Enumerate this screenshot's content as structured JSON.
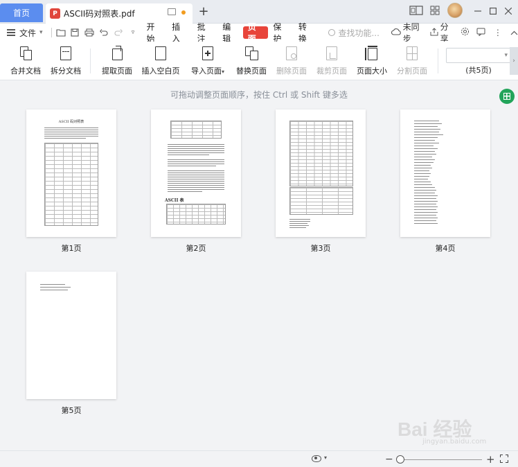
{
  "tabs": {
    "home_label": "首页",
    "document_title": "ASCII码对照表.pdf"
  },
  "menubar": {
    "file_label": "文件",
    "items": [
      "开始",
      "插入",
      "批注",
      "编辑",
      "页面",
      "保护",
      "转换"
    ],
    "active_item": "页面",
    "search_placeholder": "查找功能...",
    "sync_label": "未同步",
    "share_label": "分享"
  },
  "ribbon": {
    "buttons": [
      {
        "label": "合并文档",
        "enabled": true
      },
      {
        "label": "拆分文档",
        "enabled": true
      },
      {
        "label": "提取页面",
        "enabled": true
      },
      {
        "label": "插入空白页",
        "enabled": true
      },
      {
        "label": "导入页面",
        "enabled": true
      },
      {
        "label": "替换页面",
        "enabled": true
      },
      {
        "label": "删除页面",
        "enabled": false
      },
      {
        "label": "裁剪页面",
        "enabled": false
      },
      {
        "label": "页面大小",
        "enabled": true
      },
      {
        "label": "分割页面",
        "enabled": false
      }
    ],
    "page_total": "(共5页)"
  },
  "content": {
    "hint": "可拖动调整页面顺序，按住 Ctrl 或 Shift 键多选",
    "pages": [
      {
        "label": "第1页",
        "heading": "ASCII 码对照表"
      },
      {
        "label": "第2页",
        "heading": "ASCII 表"
      },
      {
        "label": "第3页"
      },
      {
        "label": "第4页"
      },
      {
        "label": "第5页"
      }
    ]
  },
  "colors": {
    "accent_red": "#e8443a",
    "home_tab_blue": "#5b8def",
    "green_action": "#22a45a"
  },
  "watermark": {
    "brand": "Bai 经验",
    "url": "jingyan.baidu.com"
  }
}
